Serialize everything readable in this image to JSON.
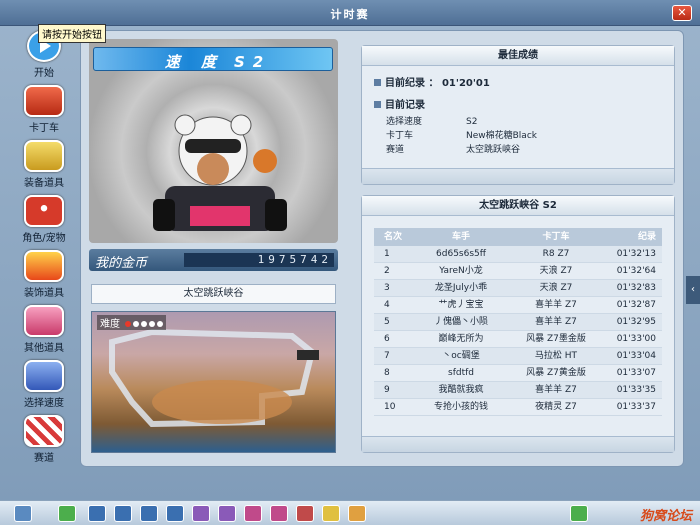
{
  "window": {
    "title": "计时赛",
    "close": "✕"
  },
  "tooltip": "请按开始按钮",
  "sidebar": {
    "items": [
      {
        "label": "开始",
        "icon": "play-icon",
        "color": "#3aa0e8"
      },
      {
        "label": "卡丁车",
        "icon": "kart-icon",
        "color": "#d8462e"
      },
      {
        "label": "装备道具",
        "icon": "goggles-icon",
        "color": "#e8c33a"
      },
      {
        "label": "角色/宠物",
        "icon": "mushroom-icon",
        "color": "#d63a2a"
      },
      {
        "label": "装饰道具",
        "icon": "flame-icon",
        "color": "#f06a1a"
      },
      {
        "label": "其他道具",
        "icon": "gift-icon",
        "color": "#e85a88"
      },
      {
        "label": "选择速度",
        "icon": "car-speed-icon",
        "color": "#4a78d8"
      },
      {
        "label": "赛道",
        "icon": "track-icon",
        "color": "#d83a3a"
      }
    ]
  },
  "speed": {
    "label": "速 度",
    "value": "S2"
  },
  "gold": {
    "label": "我的金币",
    "value": "1975742"
  },
  "track": {
    "name": "太空跳跃峡谷",
    "difficulty_label": "难度",
    "difficulty_level": 1,
    "difficulty_max": 5
  },
  "best": {
    "header": "最佳成绩",
    "target_label": "目前纪录",
    "target_value": "01'20'01",
    "current_label": "目前记录",
    "details": [
      {
        "k": "选择速度",
        "v": "S2"
      },
      {
        "k": "卡丁车",
        "v": "New棉花糖Black"
      },
      {
        "k": "赛道",
        "v": "太空跳跃峡谷"
      }
    ]
  },
  "ranking": {
    "header": "太空跳跃峡谷 S2",
    "columns": [
      "名次",
      "车手",
      "卡丁车",
      "纪录"
    ],
    "rows": [
      [
        "1",
        "6d65s6s5ff",
        "R8 Z7",
        "01'32'13"
      ],
      [
        "2",
        "YareN小龙",
        "天浪 Z7",
        "01'32'64"
      ],
      [
        "3",
        "龙圣July小乖",
        "天浪 Z7",
        "01'32'83"
      ],
      [
        "4",
        "艹虎丿宝宝",
        "喜羊羊 Z7",
        "01'32'87"
      ],
      [
        "5",
        "丿傀儡丶小陨",
        "喜羊羊 Z7",
        "01'32'95"
      ],
      [
        "6",
        "巅峰无所为",
        "风暴 Z7墨金版",
        "01'33'00"
      ],
      [
        "7",
        "丶oc碉堡",
        "马拉松 HT",
        "01'33'04"
      ],
      [
        "8",
        "sfdtfd",
        "风暴 Z7黄金版",
        "01'33'07"
      ],
      [
        "9",
        "我酷就我疯",
        "喜羊羊 Z7",
        "01'33'35"
      ],
      [
        "10",
        "专抢小孩的钱",
        "夜精灵 Z7",
        "01'33'37"
      ]
    ]
  },
  "watermark": "狗窝论坛",
  "right_tab": "‹"
}
